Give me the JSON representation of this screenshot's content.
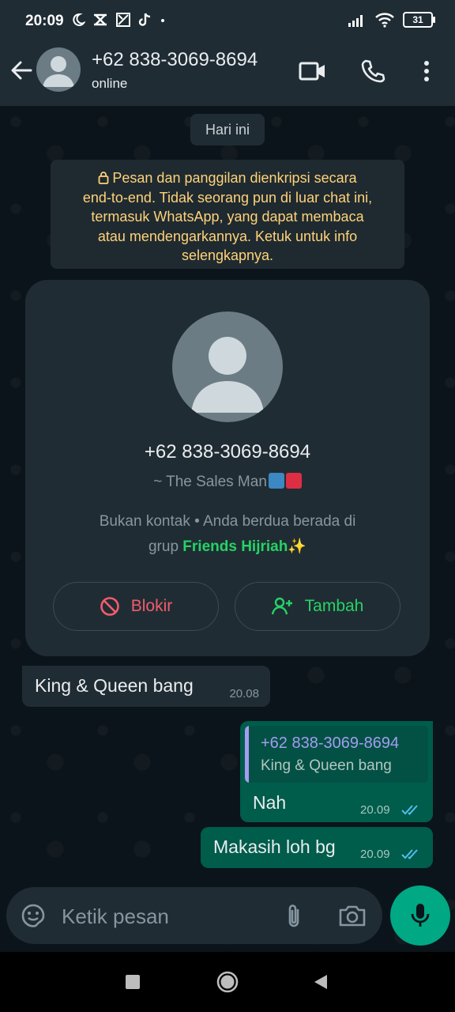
{
  "status_bar": {
    "time": "20:09",
    "battery": "31",
    "left_icons": [
      "moon-icon",
      "capcut-icon",
      "app-icon",
      "tiktok-icon",
      "dot-icon"
    ],
    "right_icons": [
      "signal-icon",
      "wifi-icon",
      "battery-icon"
    ]
  },
  "header": {
    "contact_name": "+62 838-3069-8694",
    "status": "online",
    "icons": [
      "back-arrow-icon",
      "video-call-icon",
      "voice-call-icon",
      "more-options-icon"
    ]
  },
  "chat": {
    "date_divider": "Hari ini",
    "encryption_notice": "Pesan dan panggilan dienkripsi secara end-to-end. Tidak seorang pun di luar chat ini, termasuk WhatsApp, yang dapat membaca atau mendengarkannya. Ketuk untuk info selengkapnya.",
    "encryption_lines": [
      "Pesan dan panggilan dienkripsi secara",
      "end-to-end. Tidak seorang pun di luar chat ini,",
      "termasuk WhatsApp, yang dapat membaca",
      "atau mendengarkannya. Ketuk untuk info",
      "selengkapnya."
    ]
  },
  "contact_card": {
    "number": "+62 838-3069-8694",
    "push_name": "~ The Sales Man",
    "info_prefix": "Bukan kontak • Anda berdua berada di",
    "info_line2_prefix": "grup",
    "group_name": "Friends Hijriah",
    "group_emoji": "✨",
    "block_label": "Blokir",
    "add_label": "Tambah",
    "colors": {
      "block": "#f15c6d",
      "add": "#25d366"
    }
  },
  "messages": [
    {
      "direction": "incoming",
      "text": "King & Queen bang",
      "time": "20.08"
    },
    {
      "direction": "outgoing",
      "quote": {
        "author": "+62 838-3069-8694",
        "text": "King & Queen bang"
      },
      "text": "Nah",
      "time": "20.09",
      "read": true
    },
    {
      "direction": "outgoing",
      "text": "Makasih loh bg",
      "time": "20.09",
      "read": true
    }
  ],
  "composer": {
    "placeholder": "Ketik pesan",
    "icons": [
      "emoji-icon",
      "attach-icon",
      "camera-icon",
      "mic-icon"
    ]
  },
  "nav_bar": {
    "icons": [
      "recents-square-icon",
      "home-circle-icon",
      "back-triangle-icon"
    ]
  },
  "theme": {
    "header_bg": "#1f2c34",
    "chat_bg": "#0b141a",
    "outgoing_bubble": "#005c4b",
    "incoming_bubble": "#202c33",
    "accent": "#00a884",
    "read_ticks": "#53bdeb"
  }
}
